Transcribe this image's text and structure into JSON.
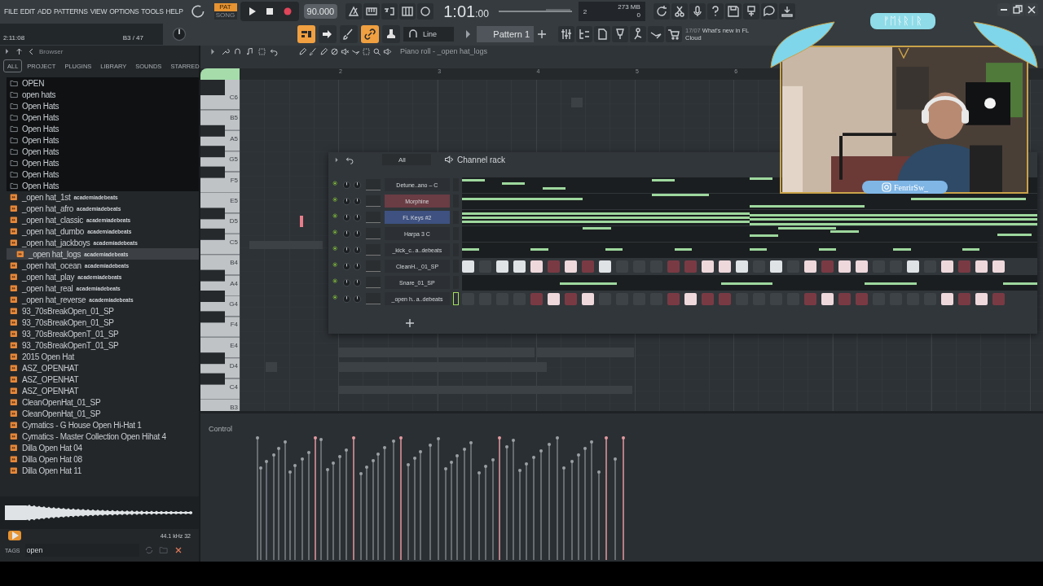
{
  "menu": [
    "FILE",
    "EDIT",
    "ADD",
    "PATTERNS",
    "VIEW",
    "OPTIONS",
    "TOOLS",
    "HELP"
  ],
  "transport": {
    "modes": [
      {
        "label": "PAT",
        "selected": true
      },
      {
        "label": "SONG",
        "selected": false
      }
    ],
    "tempo": "90.000",
    "time": "1:01",
    "time_fraction": ":00"
  },
  "monitor": {
    "cpu": "2",
    "memory": "273 MB",
    "polyphony": "0"
  },
  "hint": {
    "time": "2:11:08",
    "note": "B3 / 47"
  },
  "tools": [
    {
      "kind": "playlist",
      "on": true
    },
    {
      "kind": "arrow",
      "on": false
    },
    {
      "kind": "brush",
      "on": false
    },
    {
      "kind": "link",
      "on": true
    },
    {
      "kind": "stamp",
      "on": false
    }
  ],
  "snap": "Line",
  "pattern": "Pattern 1",
  "news": {
    "date": "17/07",
    "text": "What's new in FL Cloud"
  },
  "browser": {
    "title": "Browser",
    "tabs": [
      {
        "label": "ALL",
        "selected": true
      },
      {
        "label": "PROJECT",
        "selected": false
      },
      {
        "label": "PLUGINS",
        "selected": false
      },
      {
        "label": "LIBRARY",
        "selected": false
      },
      {
        "label": "SOUNDS",
        "selected": false
      },
      {
        "label": "STARRED",
        "selected": false
      }
    ],
    "items": [
      {
        "kind": "folder",
        "label": "OPEN",
        "selected": false
      },
      {
        "kind": "folder",
        "label": "open hats",
        "selected": false
      },
      {
        "kind": "folder",
        "label": "Open Hats",
        "selected": false
      },
      {
        "kind": "folder",
        "label": "Open Hats",
        "selected": false
      },
      {
        "kind": "folder",
        "label": "Open Hats",
        "selected": false
      },
      {
        "kind": "folder",
        "label": "Open Hats",
        "selected": false
      },
      {
        "kind": "folder",
        "label": "Open Hats",
        "selected": false
      },
      {
        "kind": "folder",
        "label": "Open Hats",
        "selected": false
      },
      {
        "kind": "folder",
        "label": "Open Hats",
        "selected": false
      },
      {
        "kind": "folder",
        "label": "Open Hats",
        "selected": false
      },
      {
        "kind": "sample",
        "label": "_open hat_1st",
        "tag": "academiadebeats",
        "selected": false
      },
      {
        "kind": "sample",
        "label": "_open hat_afro",
        "tag": "academiadebeats",
        "selected": false
      },
      {
        "kind": "sample",
        "label": "_open hat_classic",
        "tag": "academiadebeats",
        "selected": false
      },
      {
        "kind": "sample",
        "label": "_open hat_dumbo",
        "tag": "academiadebeats",
        "selected": false
      },
      {
        "kind": "sample",
        "label": "_open hat_jackboys",
        "tag": "academiadebeats",
        "selected": false
      },
      {
        "kind": "sample",
        "label": "_open hat_logs",
        "tag": "academiadebeats",
        "selected": true
      },
      {
        "kind": "sample",
        "label": "_open hat_ocean",
        "tag": "academiadebeats",
        "selected": false
      },
      {
        "kind": "sample",
        "label": "_open hat_play",
        "tag": "academiadebeats",
        "selected": false
      },
      {
        "kind": "sample",
        "label": "_open hat_real",
        "tag": "academiadebeats",
        "selected": false
      },
      {
        "kind": "sample",
        "label": "_open hat_reverse",
        "tag": "academiadebeats",
        "selected": false
      },
      {
        "kind": "sample",
        "label": "93_70sBreakOpen_01_SP",
        "selected": false
      },
      {
        "kind": "sample",
        "label": "93_70sBreakOpen_01_SP",
        "selected": false
      },
      {
        "kind": "sample",
        "label": "93_70sBreakOpenT_01_SP",
        "selected": false
      },
      {
        "kind": "sample",
        "label": "93_70sBreakOpenT_01_SP",
        "selected": false
      },
      {
        "kind": "sample",
        "label": "2015 Open Hat",
        "selected": false
      },
      {
        "kind": "sample",
        "label": "ASZ_OPENHAT",
        "selected": false
      },
      {
        "kind": "sample",
        "label": "ASZ_OPENHAT",
        "selected": false
      },
      {
        "kind": "sample",
        "label": "ASZ_OPENHAT",
        "selected": false
      },
      {
        "kind": "sample",
        "label": "CleanOpenHat_01_SP",
        "selected": false
      },
      {
        "kind": "sample",
        "label": "CleanOpenHat_01_SP",
        "selected": false
      },
      {
        "kind": "sample",
        "label": "Cymatics - G House Open Hi-Hat 1",
        "selected": false
      },
      {
        "kind": "sample",
        "label": "Cymatics - Master Collection Open Hihat 4",
        "selected": false
      },
      {
        "kind": "sample",
        "label": "Dilla Open Hat 04",
        "selected": false
      },
      {
        "kind": "sample",
        "label": "Dilla Open Hat 08",
        "selected": false
      },
      {
        "kind": "sample",
        "label": "Dilla Open Hat 11",
        "selected": false
      }
    ],
    "sample_info": "44.1 kHz 32",
    "tags": {
      "label": "TAGS",
      "value": "open"
    }
  },
  "piano_roll": {
    "title": "Piano roll - _open hat_logs",
    "ruler": [
      "2",
      "3",
      "4",
      "5",
      "6"
    ],
    "keys": [
      "C6",
      "B5",
      "A5",
      "G5",
      "F5",
      "E5",
      "D5",
      "C5",
      "B4",
      "A4",
      "G4",
      "F4",
      "E4",
      "D4",
      "C4",
      "B3"
    ],
    "control": "Control"
  },
  "channel_rack": {
    "filter": "All",
    "title": "Channel rack",
    "channels": [
      {
        "name": "Detune..ano – C",
        "kind": "notes",
        "color": "#2c3034",
        "selected": false
      },
      {
        "name": "Morphine",
        "kind": "notes",
        "color": "#6a3c44",
        "selected": false
      },
      {
        "name": "FL Keys #2",
        "kind": "notes",
        "color": "#3e5180",
        "selected": false
      },
      {
        "name": "Harpa 3 C",
        "kind": "notes",
        "color": "#2c3034",
        "selected": false
      },
      {
        "name": "_kick_c..",
        "tag": "a..debeats",
        "kind": "notes",
        "color": "#2c3034",
        "selected": false
      },
      {
        "name": "CleanH.._01_SP",
        "kind": "steps",
        "color": "#2c3034",
        "selected": false,
        "steps": [
          true,
          false,
          true,
          true,
          true,
          false,
          true,
          false,
          true,
          false,
          false,
          false,
          false,
          false,
          true,
          true,
          true,
          false,
          true,
          false,
          true,
          false,
          true,
          true,
          false,
          false,
          true,
          false,
          true,
          false,
          true,
          true
        ]
      },
      {
        "name": "Snare_01_SP",
        "kind": "notes",
        "color": "#2c3034",
        "selected": false
      },
      {
        "name": "_open h..",
        "tag": "a..debeats",
        "kind": "steps",
        "color": "#2c3034",
        "selected": true,
        "steps": [
          false,
          false,
          false,
          false,
          false,
          true,
          false,
          true,
          false,
          false,
          false,
          false,
          false,
          true,
          false,
          false,
          false,
          false,
          false,
          false,
          false,
          true,
          false,
          false,
          false,
          false,
          false,
          false,
          true,
          false,
          true,
          false
        ]
      }
    ]
  },
  "webcam": {
    "banner": "ᚠᛖᚾᚱᛁᚱ",
    "handle": "FenrirSw_"
  }
}
